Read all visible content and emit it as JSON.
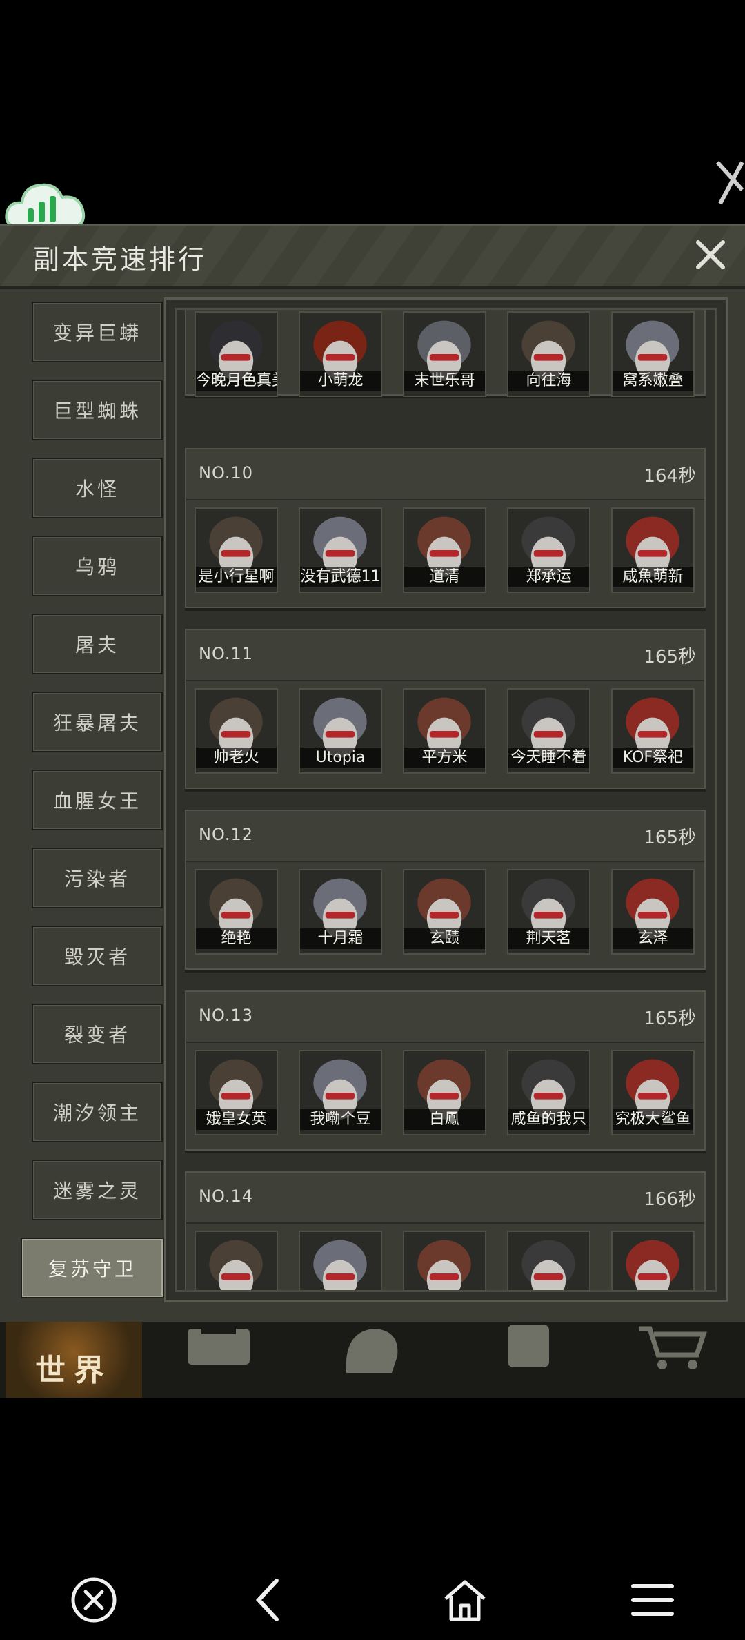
{
  "dialog": {
    "title": "副本竞速排行"
  },
  "categories": [
    {
      "label": "变异巨蟒",
      "active": false
    },
    {
      "label": "巨型蜘蛛",
      "active": false
    },
    {
      "label": "水怪",
      "active": false
    },
    {
      "label": "乌鸦",
      "active": false
    },
    {
      "label": "屠夫",
      "active": false
    },
    {
      "label": "狂暴屠夫",
      "active": false
    },
    {
      "label": "血腥女王",
      "active": false
    },
    {
      "label": "污染者",
      "active": false
    },
    {
      "label": "毁灭者",
      "active": false
    },
    {
      "label": "裂变者",
      "active": false
    },
    {
      "label": "潮汐领主",
      "active": false
    },
    {
      "label": "迷雾之灵",
      "active": false
    },
    {
      "label": "复苏守卫",
      "active": true
    }
  ],
  "partial_top_row": {
    "members": [
      "今晚月色真美",
      "小萌龙",
      "末世乐哥",
      "向往海",
      "窝系嫩叠"
    ]
  },
  "rankings": [
    {
      "no": "NO.10",
      "time": "164秒",
      "members": [
        "是小行星啊",
        "没有武德11",
        "道清",
        "郑承运",
        "咸魚萌新"
      ]
    },
    {
      "no": "NO.11",
      "time": "165秒",
      "members": [
        "帅老火",
        "Utopia",
        "平方米",
        "今天睡不着",
        "KOF祭祀"
      ]
    },
    {
      "no": "NO.12",
      "time": "165秒",
      "members": [
        "绝艳",
        "十月霜",
        "玄赜",
        "荆天茗",
        "玄泽"
      ]
    },
    {
      "no": "NO.13",
      "time": "165秒",
      "members": [
        "娥皇女英",
        "我嘞个豆",
        "白鳳",
        "咸鱼的我只",
        "究极大鲨鱼"
      ]
    },
    {
      "no": "NO.14",
      "time": "166秒",
      "members": [
        "",
        "",
        "",
        "",
        ""
      ]
    }
  ],
  "game_nav": {
    "world_label": "世界"
  },
  "colors": {
    "accent_active": "#7b7c6e",
    "panel": "#3b3c34",
    "world_tab": "#8a5a20"
  }
}
